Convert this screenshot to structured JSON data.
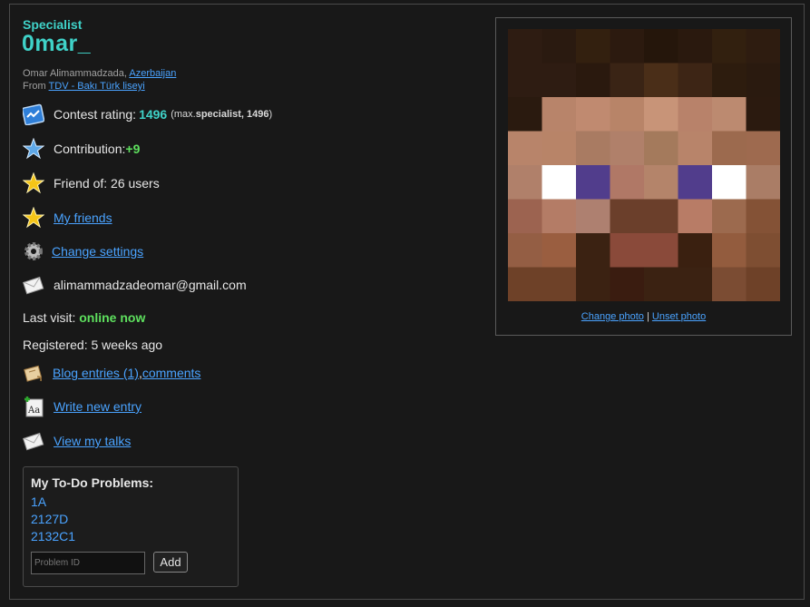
{
  "profile": {
    "rank": "Specialist",
    "handle": "0mar_",
    "name_prefix": "Omar Alimammadzada, ",
    "country": "Azerbaijan",
    "from_label": "From ",
    "organization": "TDV - Bakı Türk liseyi"
  },
  "stats": {
    "rating_label": "Contest rating: ",
    "rating_value": "1496",
    "max_open": "(max. ",
    "max_value": "specialist, 1496",
    "max_close": ")",
    "contribution_label": "Contribution: ",
    "contribution_value": "+9",
    "friend_of": "Friend of: 26 users",
    "my_friends": "My friends",
    "change_settings": "Change settings",
    "email": "alimammadzadeomar@gmail.com",
    "last_visit_label": "Last visit: ",
    "last_visit_value": "online now",
    "registered": "Registered: 5 weeks ago",
    "blog_entries": "Blog entries (1)",
    "blog_sep": ", ",
    "comments": "comments",
    "write_new_entry": "Write new entry",
    "view_my_talks": "View my talks"
  },
  "todo": {
    "title": "My To-Do Problems:",
    "items": [
      "1A",
      "2127D",
      "2132C1"
    ],
    "placeholder": "Problem ID",
    "add_label": "Add"
  },
  "photo": {
    "change_photo": "Change photo",
    "separator": " | ",
    "unset_photo": "Unset photo"
  },
  "icons": {
    "rating": "rating-chart-icon",
    "contribution": "blue-star-icon",
    "friend_of": "star-icon",
    "my_friends": "star-icon",
    "settings": "gear-icon",
    "email": "envelope-icon",
    "blog": "blog-scroll-icon",
    "write": "write-entry-icon",
    "talks": "envelope-icon"
  },
  "colors": {
    "accent_cyan": "#3fd2c8",
    "online_green": "#5ee05e",
    "link_blue": "#4aa3ff"
  }
}
